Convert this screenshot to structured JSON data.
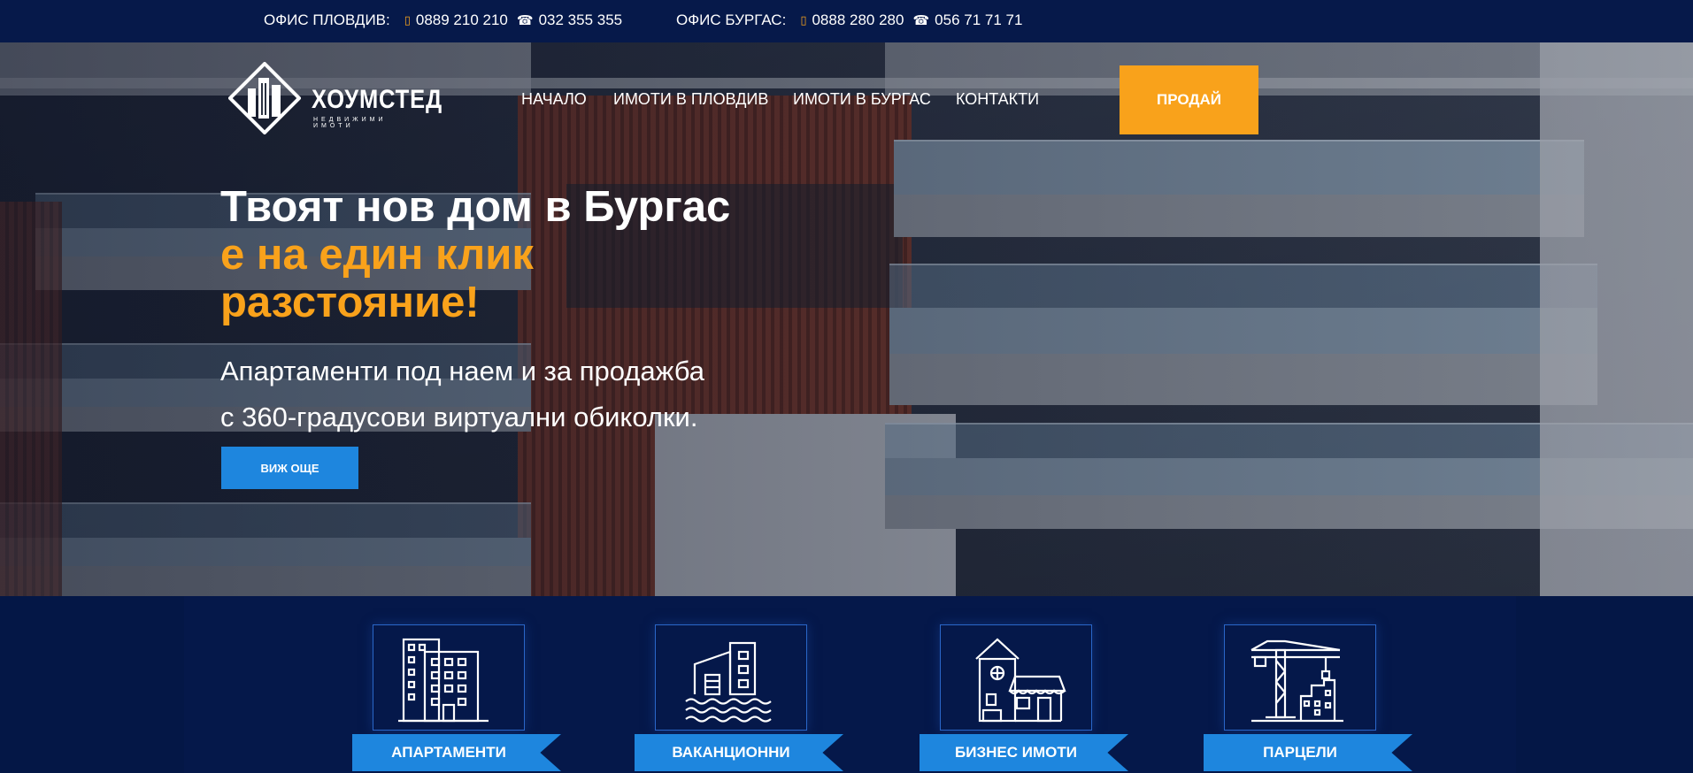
{
  "topbar": {
    "plovdiv": {
      "label": "ОФИС ПЛОВДИВ:",
      "mobile": "0889 210 210",
      "phone": "032 355 355"
    },
    "burgas": {
      "label": "ОФИС БУРГАС:",
      "mobile": "0888 280 280",
      "phone": "056 71 71 71"
    }
  },
  "logo": {
    "name": "ХОУМСТЕД",
    "tagline": "НЕДВИЖИМИ ИМОТИ"
  },
  "nav": {
    "items": [
      "НАЧАЛО",
      "ИМОТИ В ПЛОВДИВ",
      "ИМОТИ В БУРГАС",
      "КОНТАКТИ"
    ],
    "sell_label": "ПРОДАЙ"
  },
  "hero": {
    "line1": "Твоят нов дом в Бургас",
    "line2": "е на един клик",
    "line3": "разстояние!",
    "sub1": "Апартаменти под наем и за продажба",
    "sub2": "с 360-градусови виртуални обиколки.",
    "button_label": "ВИЖ ОЩЕ"
  },
  "categories": [
    {
      "label": "АПАРТАМЕНТИ",
      "icon": "apartment-building-icon"
    },
    {
      "label": "ВАКАНЦИОННИ",
      "icon": "vacation-building-icon"
    },
    {
      "label": "БИЗНЕС ИМОТИ",
      "icon": "business-shop-icon"
    },
    {
      "label": "ПАРЦЕЛИ",
      "icon": "construction-crane-icon"
    }
  ],
  "colors": {
    "navy": "#06194a",
    "orange": "#f9a21b",
    "blue": "#1e86de"
  }
}
